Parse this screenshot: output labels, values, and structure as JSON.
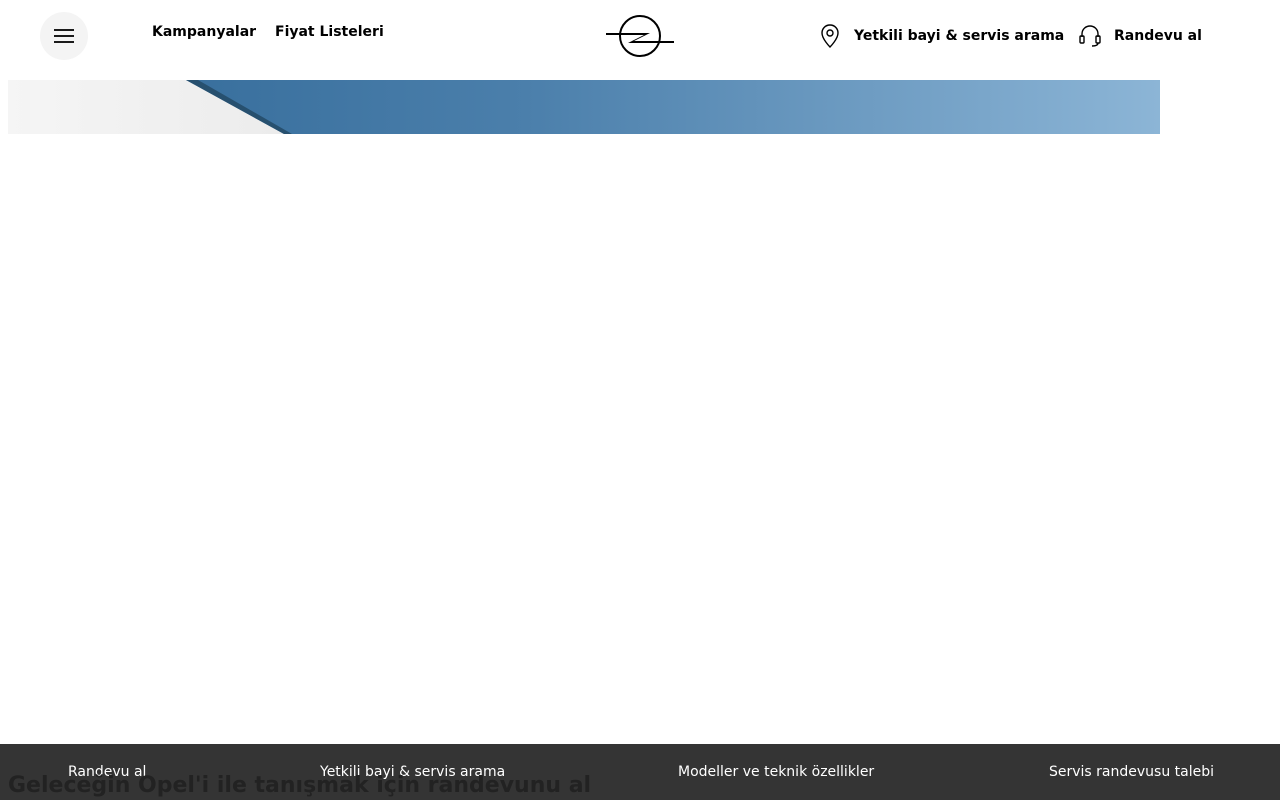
{
  "header": {
    "nav": {
      "campaigns": "Kampanyalar",
      "price_lists": "Fiyat Listeleri"
    },
    "actions": {
      "dealer_search": "Yetkili bayi & servis arama",
      "appointment": "Randevu al"
    }
  },
  "hero": {
    "title": "Geleceğin Opel'i ile tanışmak için randevunu al"
  },
  "bottom_bar": {
    "links": [
      "Randevu al",
      "Yetkili bayi & servis arama",
      "Modeller ve teknik özellikler",
      "Servis randevusu talebi"
    ]
  },
  "icons": {
    "menu": "hamburger-icon",
    "location": "location-pin-icon",
    "headset": "headset-icon",
    "logo": "opel-logo"
  },
  "colors": {
    "bottom_bar_bg": "#343434",
    "hero_blue": "#4a7fab"
  }
}
